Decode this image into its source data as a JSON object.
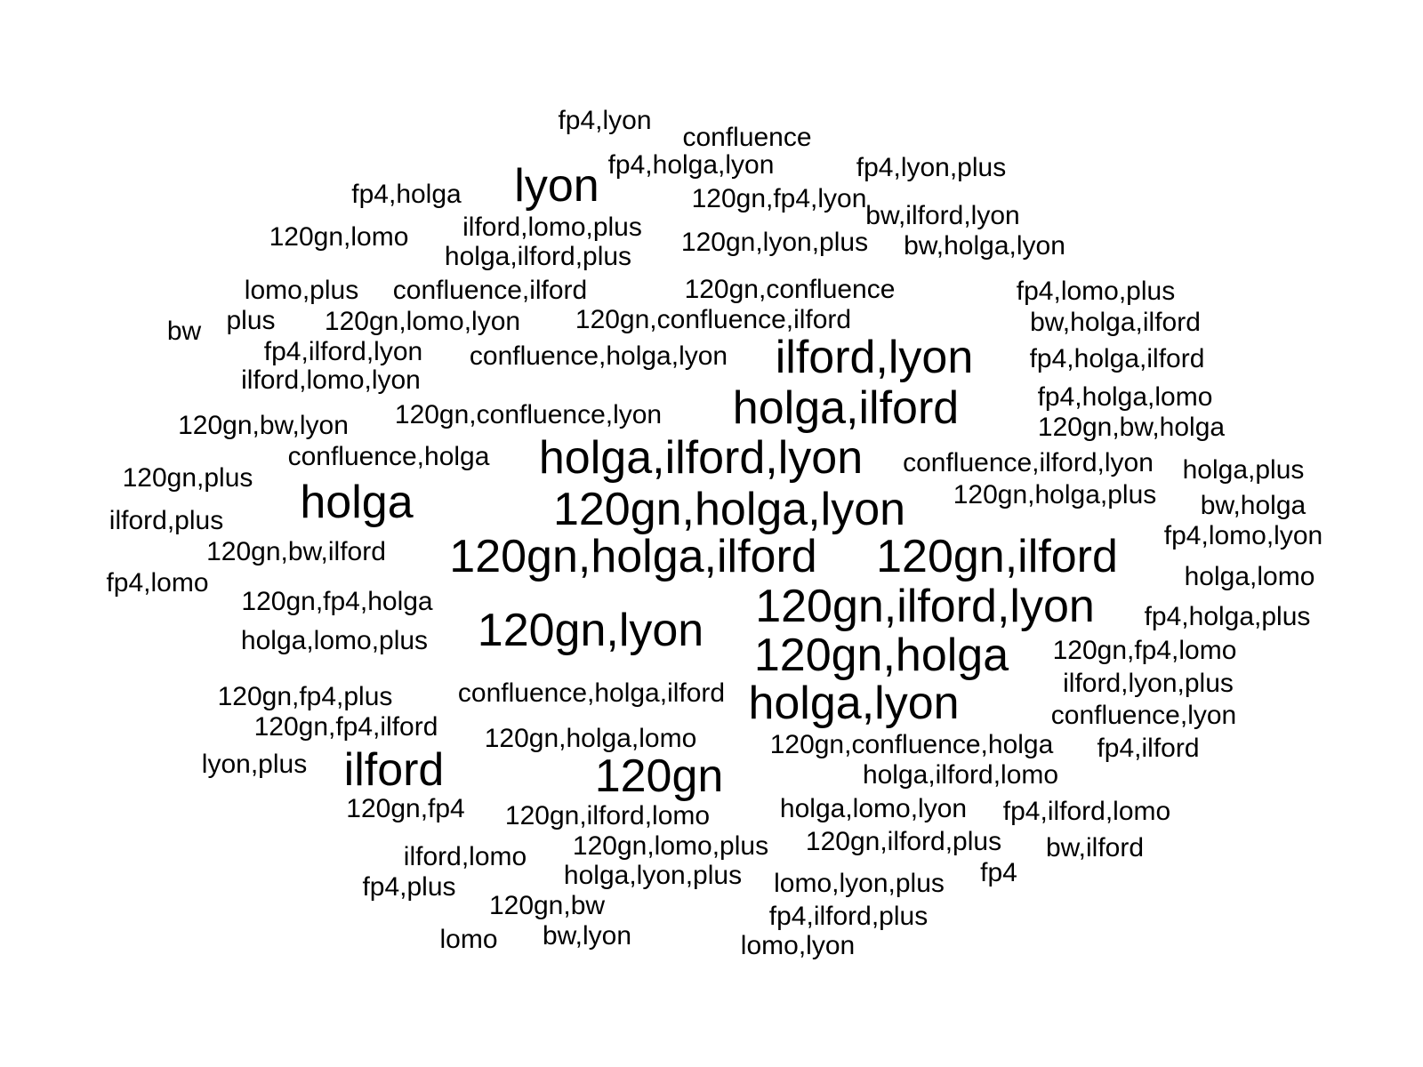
{
  "chart_data": {
    "type": "wordcloud",
    "color": "#000000",
    "background": "#ffffff",
    "words": [
      {
        "text": "120gn,holga,lyon",
        "weight": 5
      },
      {
        "text": "120gn,holga,ilford",
        "weight": 5
      },
      {
        "text": "holga,ilford,lyon",
        "weight": 5
      },
      {
        "text": "120gn,ilford,lyon",
        "weight": 5
      },
      {
        "text": "120gn,ilford",
        "weight": 5
      },
      {
        "text": "120gn,lyon",
        "weight": 5
      },
      {
        "text": "120gn,holga",
        "weight": 5
      },
      {
        "text": "ilford,lyon",
        "weight": 5
      },
      {
        "text": "holga,ilford",
        "weight": 5
      },
      {
        "text": "holga,lyon",
        "weight": 5
      },
      {
        "text": "lyon",
        "weight": 5
      },
      {
        "text": "holga",
        "weight": 5
      },
      {
        "text": "ilford",
        "weight": 5
      },
      {
        "text": "120gn",
        "weight": 5
      },
      {
        "text": "fp4,lyon",
        "weight": 1
      },
      {
        "text": "confluence",
        "weight": 1
      },
      {
        "text": "fp4,holga,lyon",
        "weight": 1
      },
      {
        "text": "fp4,lyon,plus",
        "weight": 1
      },
      {
        "text": "fp4,holga",
        "weight": 1
      },
      {
        "text": "120gn,fp4,lyon",
        "weight": 1
      },
      {
        "text": "bw,ilford,lyon",
        "weight": 1
      },
      {
        "text": "120gn,lomo",
        "weight": 1
      },
      {
        "text": "ilford,lomo,plus",
        "weight": 1
      },
      {
        "text": "holga,ilford,plus",
        "weight": 1
      },
      {
        "text": "120gn,lyon,plus",
        "weight": 1
      },
      {
        "text": "bw,holga,lyon",
        "weight": 1
      },
      {
        "text": "lomo,plus",
        "weight": 1
      },
      {
        "text": "confluence,ilford",
        "weight": 1
      },
      {
        "text": "120gn,confluence",
        "weight": 1
      },
      {
        "text": "fp4,lomo,plus",
        "weight": 1
      },
      {
        "text": "bw",
        "weight": 1
      },
      {
        "text": "plus",
        "weight": 1
      },
      {
        "text": "120gn,lomo,lyon",
        "weight": 1
      },
      {
        "text": "120gn,confluence,ilford",
        "weight": 1
      },
      {
        "text": "bw,holga,ilford",
        "weight": 1
      },
      {
        "text": "fp4,ilford,lyon",
        "weight": 1
      },
      {
        "text": "confluence,holga,lyon",
        "weight": 1
      },
      {
        "text": "fp4,holga,ilford",
        "weight": 1
      },
      {
        "text": "ilford,lomo,lyon",
        "weight": 1
      },
      {
        "text": "fp4,holga,lomo",
        "weight": 1
      },
      {
        "text": "120gn,bw,lyon",
        "weight": 1
      },
      {
        "text": "120gn,confluence,lyon",
        "weight": 1
      },
      {
        "text": "120gn,bw,holga",
        "weight": 1
      },
      {
        "text": "confluence,holga",
        "weight": 1
      },
      {
        "text": "confluence,ilford,lyon",
        "weight": 1
      },
      {
        "text": "120gn,plus",
        "weight": 1
      },
      {
        "text": "holga,plus",
        "weight": 1
      },
      {
        "text": "120gn,holga,plus",
        "weight": 1
      },
      {
        "text": "ilford,plus",
        "weight": 1
      },
      {
        "text": "bw,holga",
        "weight": 1
      },
      {
        "text": "fp4,lomo,lyon",
        "weight": 1
      },
      {
        "text": "120gn,bw,ilford",
        "weight": 1
      },
      {
        "text": "fp4,lomo",
        "weight": 1
      },
      {
        "text": "holga,lomo",
        "weight": 1
      },
      {
        "text": "120gn,fp4,holga",
        "weight": 1
      },
      {
        "text": "fp4,holga,plus",
        "weight": 1
      },
      {
        "text": "holga,lomo,plus",
        "weight": 1
      },
      {
        "text": "120gn,fp4,lomo",
        "weight": 1
      },
      {
        "text": "ilford,lyon,plus",
        "weight": 1
      },
      {
        "text": "120gn,fp4,plus",
        "weight": 1
      },
      {
        "text": "confluence,holga,ilford",
        "weight": 1
      },
      {
        "text": "confluence,lyon",
        "weight": 1
      },
      {
        "text": "120gn,fp4,ilford",
        "weight": 1
      },
      {
        "text": "120gn,holga,lomo",
        "weight": 1
      },
      {
        "text": "120gn,confluence,holga",
        "weight": 1
      },
      {
        "text": "fp4,ilford",
        "weight": 1
      },
      {
        "text": "lyon,plus",
        "weight": 1
      },
      {
        "text": "holga,ilford,lomo",
        "weight": 1
      },
      {
        "text": "120gn,fp4",
        "weight": 1
      },
      {
        "text": "holga,lomo,lyon",
        "weight": 1
      },
      {
        "text": "fp4,ilford,lomo",
        "weight": 1
      },
      {
        "text": "120gn,ilford,lomo",
        "weight": 1
      },
      {
        "text": "120gn,ilford,plus",
        "weight": 1
      },
      {
        "text": "120gn,lomo,plus",
        "weight": 1
      },
      {
        "text": "ilford,lomo",
        "weight": 1
      },
      {
        "text": "bw,ilford",
        "weight": 1
      },
      {
        "text": "holga,lyon,plus",
        "weight": 1
      },
      {
        "text": "fp4",
        "weight": 1
      },
      {
        "text": "lomo,lyon,plus",
        "weight": 1
      },
      {
        "text": "fp4,plus",
        "weight": 1
      },
      {
        "text": "120gn,bw",
        "weight": 1
      },
      {
        "text": "fp4,ilford,plus",
        "weight": 1
      },
      {
        "text": "lomo",
        "weight": 1
      },
      {
        "text": "bw,lyon",
        "weight": 1
      },
      {
        "text": "lomo,lyon",
        "weight": 1
      }
    ]
  }
}
